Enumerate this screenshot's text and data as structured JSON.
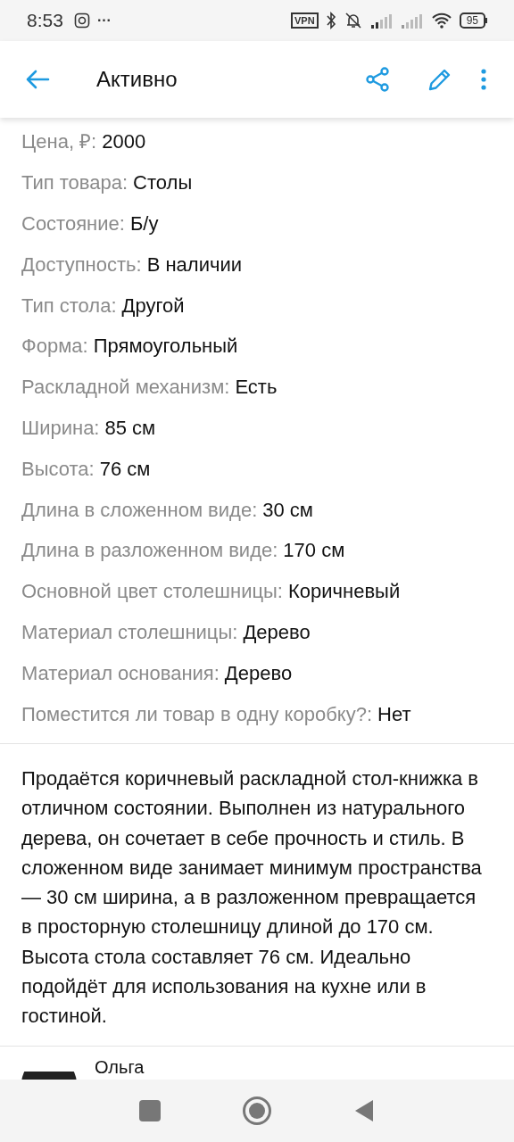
{
  "status_bar": {
    "time": "8:53",
    "more": "···",
    "vpn": "VPN",
    "battery": "95"
  },
  "header": {
    "title": "Активно"
  },
  "attributes": [
    {
      "label": "Цена, ₽:",
      "value": "2000"
    },
    {
      "label": "Тип товара:",
      "value": "Столы"
    },
    {
      "label": "Состояние:",
      "value": "Б/у"
    },
    {
      "label": "Доступность:",
      "value": "В наличии"
    },
    {
      "label": "Тип стола:",
      "value": "Другой"
    },
    {
      "label": "Форма:",
      "value": "Прямоугольный"
    },
    {
      "label": "Раскладной механизм:",
      "value": "Есть"
    },
    {
      "label": "Ширина:",
      "value": "85 см"
    },
    {
      "label": "Высота:",
      "value": "76 см"
    },
    {
      "label": "Длина в сложенном виде:",
      "value": "30 см"
    },
    {
      "label": "Длина в разложенном виде:",
      "value": "170 см"
    },
    {
      "label": "Основной цвет столешницы:",
      "value": "Коричневый"
    },
    {
      "label": "Материал столешницы:",
      "value": "Дерево"
    },
    {
      "label": "Материал основания:",
      "value": "Дерево"
    },
    {
      "label": "Поместится ли товар в одну коробку?:",
      "value": "Нет"
    }
  ],
  "description": "Продаётся коричневый раскладной стол-книжка в отличном состоянии. Выполнен из натурального дерева, он сочетает в себе прочность и стиль. В сложенном виде занимает минимум пространства — 30 см ширина, а в разложенном превращается в просторную столешницу длиной до 170 см. Высота стола составляет 76 см. Идеально подойдёт для использования на кухне или в гостиной.",
  "seller": {
    "name": "Ольга"
  }
}
